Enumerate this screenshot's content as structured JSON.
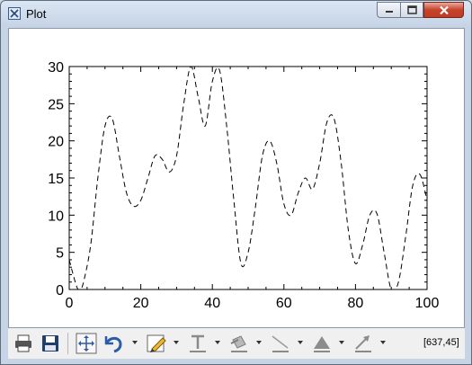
{
  "window": {
    "title": "Plot",
    "colors": {
      "close_button": "#c7432b",
      "frame": "#c6d4e6"
    }
  },
  "chart_data": {
    "type": "line",
    "title": "",
    "xlabel": "",
    "ylabel": "",
    "xlim": [
      0,
      100
    ],
    "ylim": [
      0,
      30
    ],
    "x_ticks": [
      0,
      20,
      40,
      60,
      80,
      100
    ],
    "y_ticks": [
      0,
      5,
      10,
      15,
      20,
      25,
      30
    ],
    "line_style": "dashed",
    "series": [
      {
        "x": [
          0,
          2,
          3,
          4,
          6,
          8,
          10,
          12,
          14,
          16,
          18,
          20,
          22,
          24,
          26,
          28,
          30,
          32,
          34,
          36,
          38,
          40,
          42,
          44,
          46,
          48,
          50,
          52,
          54,
          56,
          58,
          60,
          62,
          64,
          66,
          68,
          70,
          72,
          74,
          76,
          78,
          80,
          82,
          84,
          86,
          88,
          90,
          92,
          94,
          96,
          98,
          100
        ],
        "y": [
          4,
          0.5,
          0,
          1,
          6,
          15,
          22,
          23,
          18,
          13,
          11.2,
          12,
          15,
          18,
          17.5,
          15.8,
          18,
          25,
          30,
          26,
          22,
          28,
          29.5,
          22,
          12,
          3.5,
          5,
          11,
          18,
          20,
          17,
          11.5,
          10,
          13,
          15,
          13.5,
          17,
          22.5,
          23,
          17,
          8,
          3.5,
          6,
          10,
          10.2,
          5,
          0,
          1,
          7,
          14,
          15.5,
          12
        ]
      }
    ]
  },
  "toolbar": {
    "coords": "[637,45]",
    "icons": [
      "print-icon",
      "save-icon",
      "fit-to-window-icon",
      "undo-icon",
      "pencil-icon",
      "text-icon",
      "style-icon",
      "line-icon",
      "fill-icon",
      "arrow-icon"
    ]
  }
}
